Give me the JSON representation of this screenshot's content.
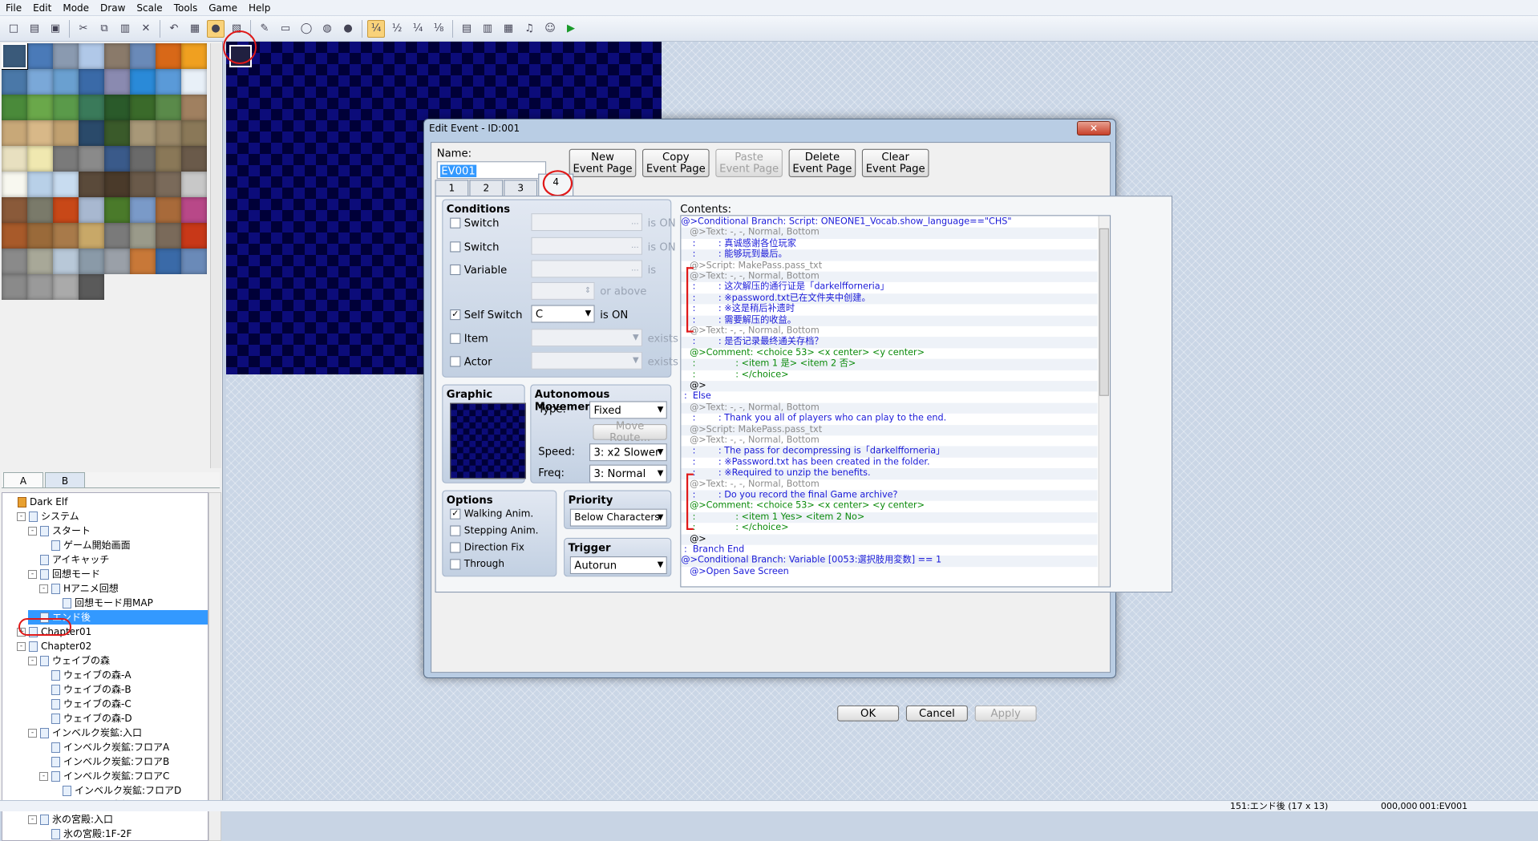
{
  "menu": [
    "File",
    "Edit",
    "Mode",
    "Draw",
    "Scale",
    "Tools",
    "Game",
    "Help"
  ],
  "toolbar_icons": [
    "new-file-icon",
    "open-folder-icon",
    "save-icon",
    "cut-icon",
    "copy-icon",
    "paste-icon",
    "delete-icon",
    "undo-icon",
    "layer-map-icon",
    "layer-event-icon",
    "layer-region-icon",
    "pencil-icon",
    "rectangle-icon",
    "ellipse-icon",
    "fill-icon",
    "shadow-pen-icon",
    "scale-1-1-icon",
    "scale-1-2-icon",
    "scale-1-4-icon",
    "scale-1-8-icon",
    "database-icon",
    "resource-manager-icon",
    "script-editor-icon",
    "sound-test-icon",
    "character-generator-icon",
    "playtest-icon"
  ],
  "tileset_tabs": [
    "A",
    "B"
  ],
  "tree": [
    {
      "label": "Dark Elf",
      "depth": 0,
      "exp": ""
    },
    {
      "label": "システム",
      "depth": 1,
      "exp": "-"
    },
    {
      "label": "スタート",
      "depth": 2,
      "exp": "-"
    },
    {
      "label": "ゲーム開始画面",
      "depth": 3,
      "exp": ""
    },
    {
      "label": "アイキャッチ",
      "depth": 2,
      "exp": ""
    },
    {
      "label": "回想モード",
      "depth": 2,
      "exp": "-"
    },
    {
      "label": "Hアニメ回想",
      "depth": 3,
      "exp": "-"
    },
    {
      "label": "回想モード用MAP",
      "depth": 4,
      "exp": ""
    },
    {
      "label": "エンド後",
      "depth": 2,
      "exp": "",
      "selected": true
    },
    {
      "label": "Chapter01",
      "depth": 1,
      "exp": "+"
    },
    {
      "label": "Chapter02",
      "depth": 1,
      "exp": "-"
    },
    {
      "label": "ウェイブの森",
      "depth": 2,
      "exp": "-"
    },
    {
      "label": "ウェイブの森-A",
      "depth": 3,
      "exp": ""
    },
    {
      "label": "ウェイブの森-B",
      "depth": 3,
      "exp": ""
    },
    {
      "label": "ウェイブの森-C",
      "depth": 3,
      "exp": ""
    },
    {
      "label": "ウェイブの森-D",
      "depth": 3,
      "exp": ""
    },
    {
      "label": "インベルク炭鉱:入口",
      "depth": 2,
      "exp": "-"
    },
    {
      "label": "インベルク炭鉱:フロアA",
      "depth": 3,
      "exp": ""
    },
    {
      "label": "インベルク炭鉱:フロアB",
      "depth": 3,
      "exp": ""
    },
    {
      "label": "インベルク炭鉱:フロアC",
      "depth": 3,
      "exp": "-"
    },
    {
      "label": "インベルク炭鉱:フロアD",
      "depth": 4,
      "exp": ""
    },
    {
      "label": "インベルク炭鉱:ボス",
      "depth": 3,
      "exp": ""
    },
    {
      "label": "氷の宮殿:入口",
      "depth": 2,
      "exp": "-"
    },
    {
      "label": "氷の宮殿:1F-2F",
      "depth": 3,
      "exp": ""
    }
  ],
  "status": {
    "map": "151:エンド後 (17 x 13)",
    "coords": "000,000",
    "event": "001:EV001"
  },
  "dialog": {
    "title": "Edit Event - ID:001",
    "close": "✕",
    "name_label": "Name:",
    "name_value": "EV001",
    "buttons": {
      "new_page": "New\nEvent Page",
      "copy_page": "Copy\nEvent Page",
      "paste_page": "Paste\nEvent Page",
      "delete_page": "Delete\nEvent Page",
      "clear_page": "Clear\nEvent Page"
    },
    "page_tabs": [
      "1",
      "2",
      "3",
      "4"
    ],
    "conditions": {
      "title": "Conditions",
      "switch1": "Switch",
      "switch2": "Switch",
      "variable": "Variable",
      "self_switch": "Self Switch",
      "item": "Item",
      "actor": "Actor",
      "is_on": "is ON",
      "is": "is",
      "or_above": "or above",
      "exists": "exists",
      "self_switch_value": "C",
      "ellipsis": "..."
    },
    "graphic": {
      "title": "Graphic"
    },
    "movement": {
      "title": "Autonomous Movement",
      "type_label": "Type:",
      "type_value": "Fixed",
      "move_route": "Move Route...",
      "speed_label": "Speed:",
      "speed_value": "3: x2 Slower",
      "freq_label": "Freq:",
      "freq_value": "3: Normal"
    },
    "options": {
      "title": "Options",
      "walking": "Walking Anim.",
      "stepping": "Stepping Anim.",
      "direction_fix": "Direction Fix",
      "through": "Through"
    },
    "priority": {
      "title": "Priority",
      "value": "Below Characters"
    },
    "trigger": {
      "title": "Trigger",
      "value": "Autorun"
    },
    "contents_label": "Contents:",
    "contents": [
      {
        "t": "@>Conditional Branch: Script: ONEONE1_Vocab.show_language==\"CHS\"",
        "c": "blue"
      },
      {
        "t": "   @>Text: -, -, Normal, Bottom",
        "c": "gray"
      },
      {
        "t": "    :        : 真诚感谢各位玩家",
        "c": "blue"
      },
      {
        "t": "    :        : 能够玩到最后。",
        "c": "blue"
      },
      {
        "t": "   @>Script: MakePass.pass_txt",
        "c": "gray"
      },
      {
        "t": "   @>Text: -, -, Normal, Bottom",
        "c": "gray"
      },
      {
        "t": "    :        : 这次解压的通行证是「darkelfforneria」",
        "c": "blue"
      },
      {
        "t": "    :        : ※password.txt已在文件夹中创建。",
        "c": "blue"
      },
      {
        "t": "    :        : ※这是稍后补遗时",
        "c": "blue"
      },
      {
        "t": "    :        : 需要解压的收益。",
        "c": "blue"
      },
      {
        "t": "   @>Text: -, -, Normal, Bottom",
        "c": "gray"
      },
      {
        "t": "    :        : 是否记录最终通关存档？",
        "c": "blue"
      },
      {
        "t": "   @>Comment: <choice 53> <x center> <y center>",
        "c": "green"
      },
      {
        "t": "    :              : <item 1 是> <item 2 否>",
        "c": "green"
      },
      {
        "t": "    :              : </choice>",
        "c": "green"
      },
      {
        "t": "   @>",
        "c": "black"
      },
      {
        "t": " :  Else",
        "c": "blue"
      },
      {
        "t": "   @>Text: -, -, Normal, Bottom",
        "c": "gray"
      },
      {
        "t": "    :        : Thank you all of players who can play to the end.",
        "c": "blue"
      },
      {
        "t": "   @>Script: MakePass.pass_txt",
        "c": "gray"
      },
      {
        "t": "   @>Text: -, -, Normal, Bottom",
        "c": "gray"
      },
      {
        "t": "    :        : The pass for decompressing is「darkelfforneria」",
        "c": "blue"
      },
      {
        "t": "    :        : ※Password.txt has been created in the folder.",
        "c": "blue"
      },
      {
        "t": "    :        : ※Required to unzip the benefits.",
        "c": "blue"
      },
      {
        "t": "   @>Text: -, -, Normal, Bottom",
        "c": "gray"
      },
      {
        "t": "    :        : Do you record the final Game archive?",
        "c": "blue"
      },
      {
        "t": "   @>Comment: <choice 53> <x center> <y center>",
        "c": "green"
      },
      {
        "t": "    :              : <item 1 Yes> <item 2 No>",
        "c": "green"
      },
      {
        "t": "    :              : </choice>",
        "c": "green"
      },
      {
        "t": "   @>",
        "c": "black"
      },
      {
        "t": " :  Branch End",
        "c": "blue"
      },
      {
        "t": "@>Conditional Branch: Variable [0053:選択肢用変数] == 1",
        "c": "blue"
      },
      {
        "t": "   @>Open Save Screen",
        "c": "blue"
      }
    ],
    "ok": "OK",
    "cancel": "Cancel",
    "apply": "Apply"
  }
}
